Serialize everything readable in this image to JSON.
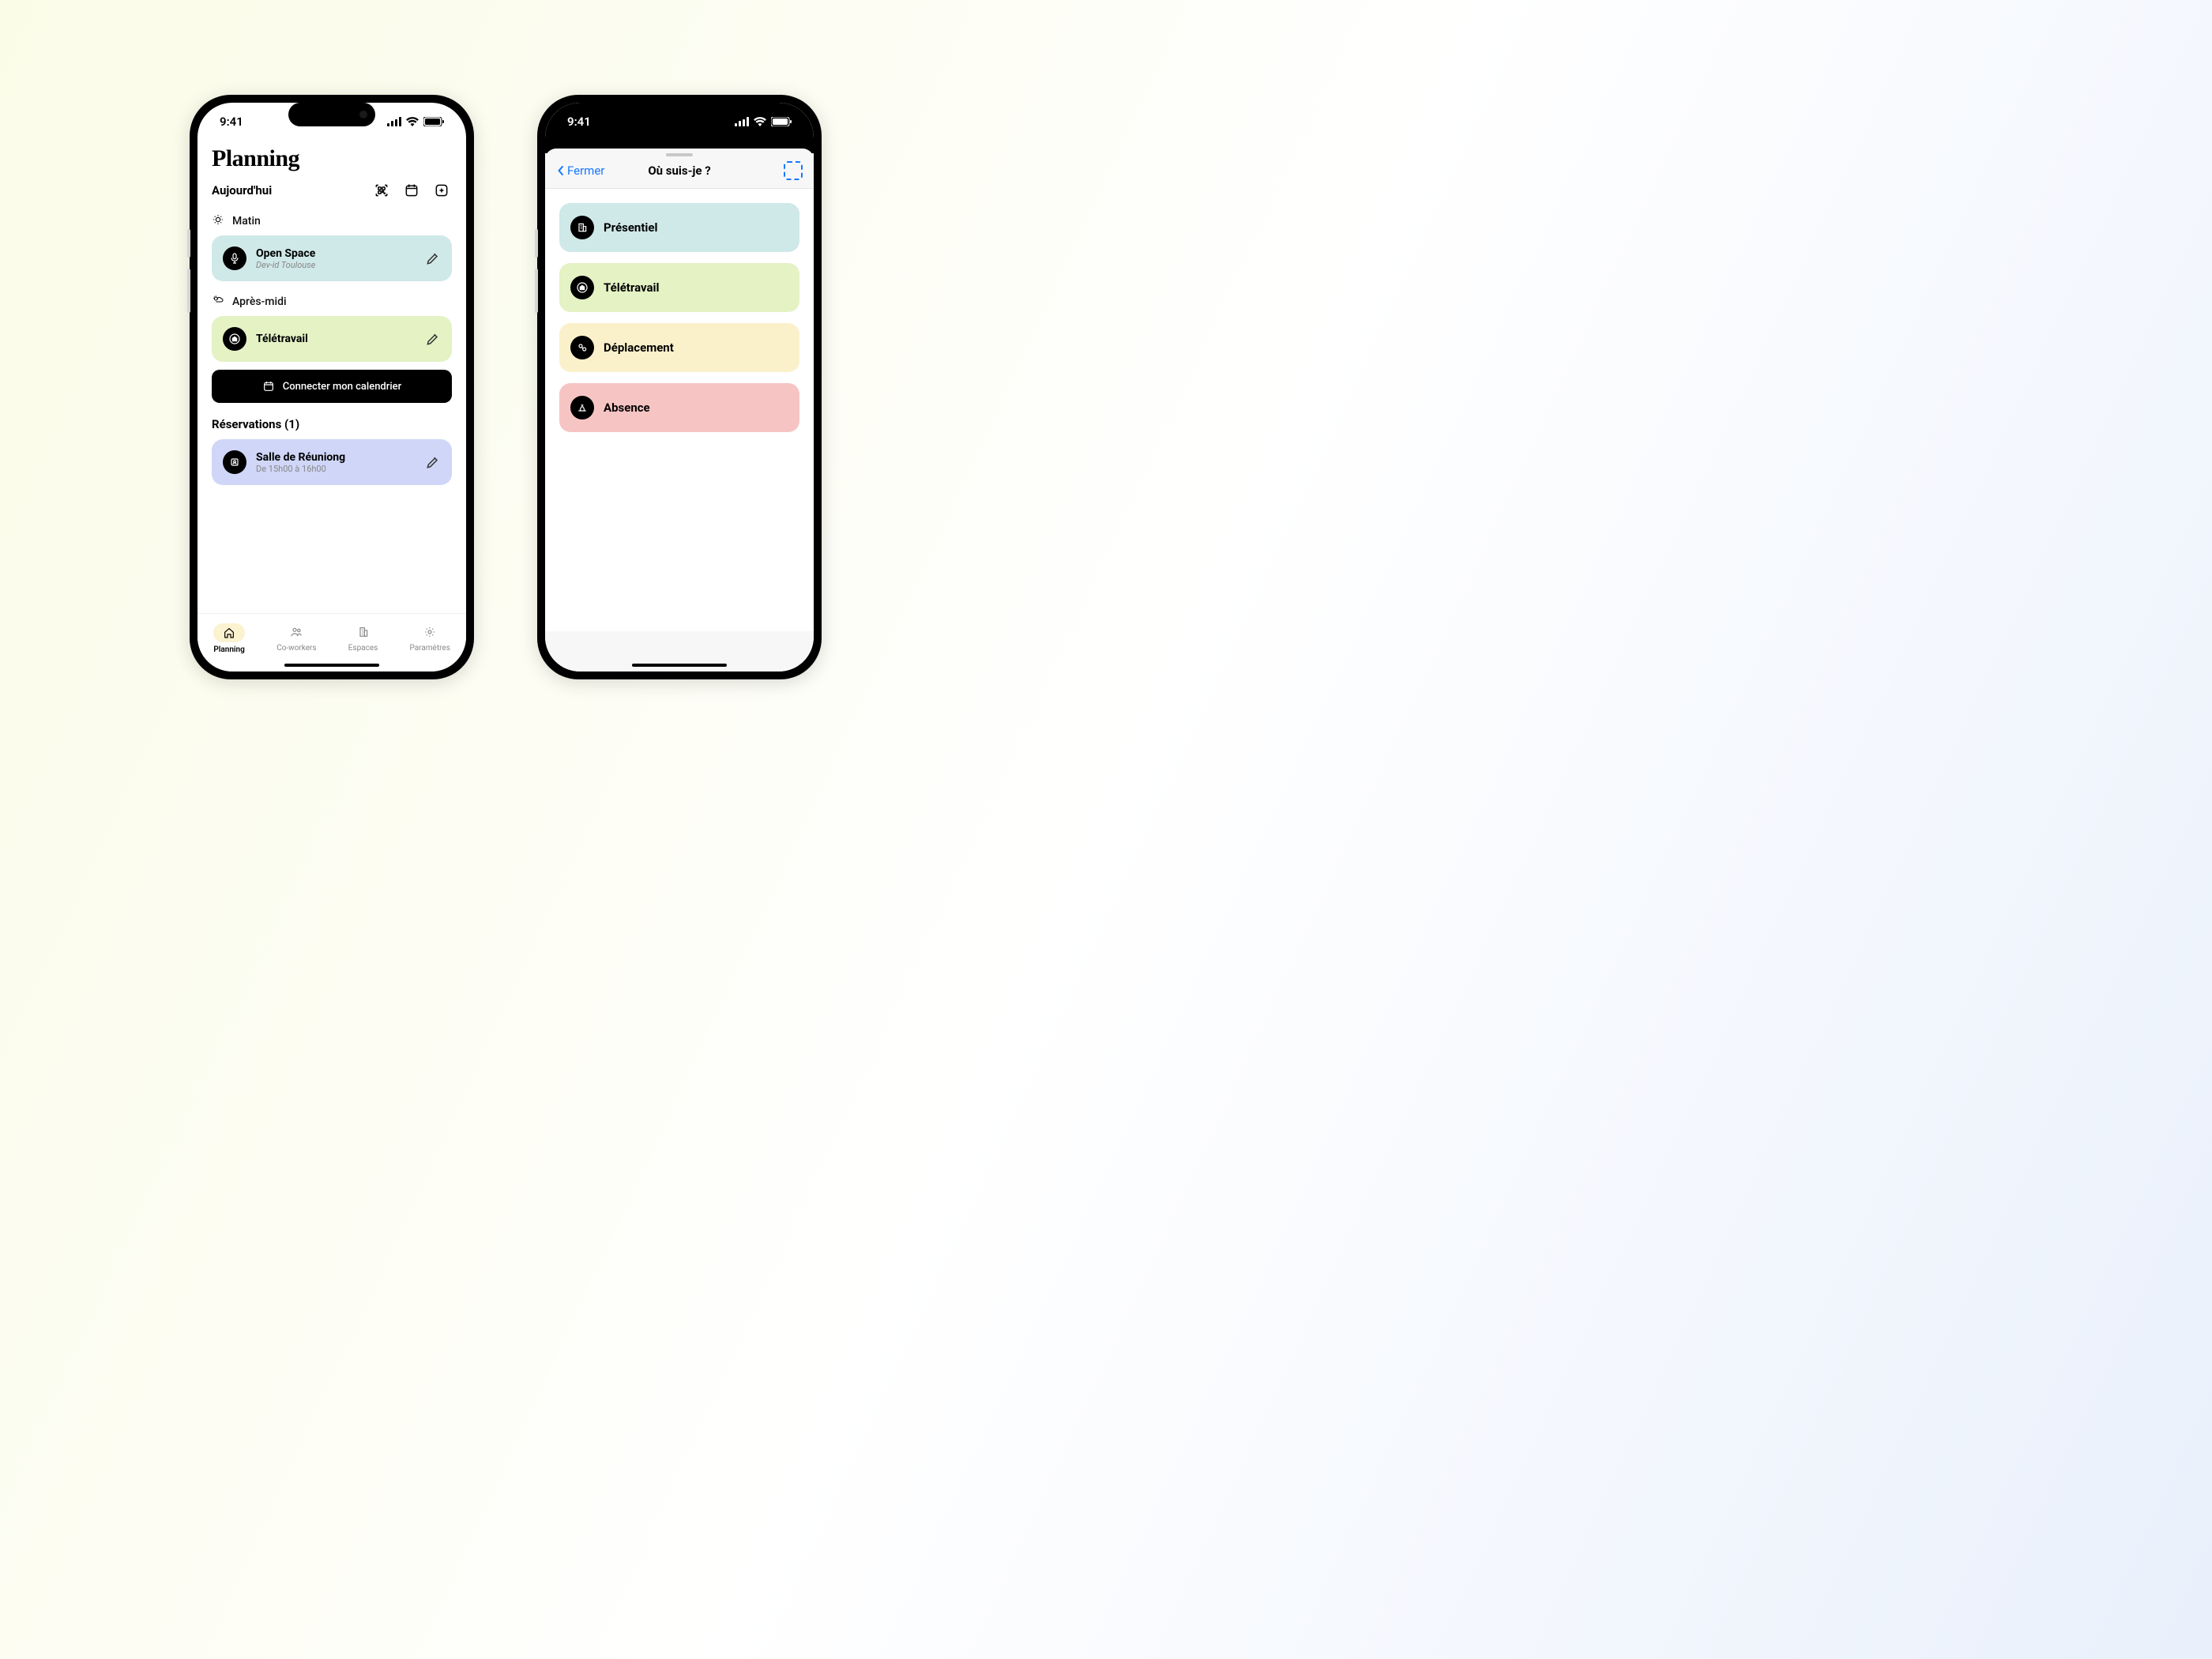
{
  "status": {
    "time": "9:41"
  },
  "planning": {
    "title": "Planning",
    "today": "Aujourd'hui",
    "morning_label": "Matin",
    "afternoon_label": "Après-midi",
    "morning": {
      "title": "Open Space",
      "sub": "Dev-id Toulouse"
    },
    "afternoon": {
      "title": "Télétravail"
    },
    "connect_calendar": "Connecter mon calendrier",
    "reservations_heading": "Réservations (1)",
    "reservation": {
      "title": "Salle de Réuniong",
      "sub": "De 15h00 à 16h00"
    }
  },
  "tabs": {
    "planning": "Planning",
    "coworkers": "Co-workers",
    "spaces": "Espaces",
    "settings": "Paramètres"
  },
  "modal": {
    "close": "Fermer",
    "title": "Où suis-je ?",
    "options": {
      "presentiel": "Présentiel",
      "teletravail": "Télétravail",
      "deplacement": "Déplacement",
      "absence": "Absence"
    }
  }
}
